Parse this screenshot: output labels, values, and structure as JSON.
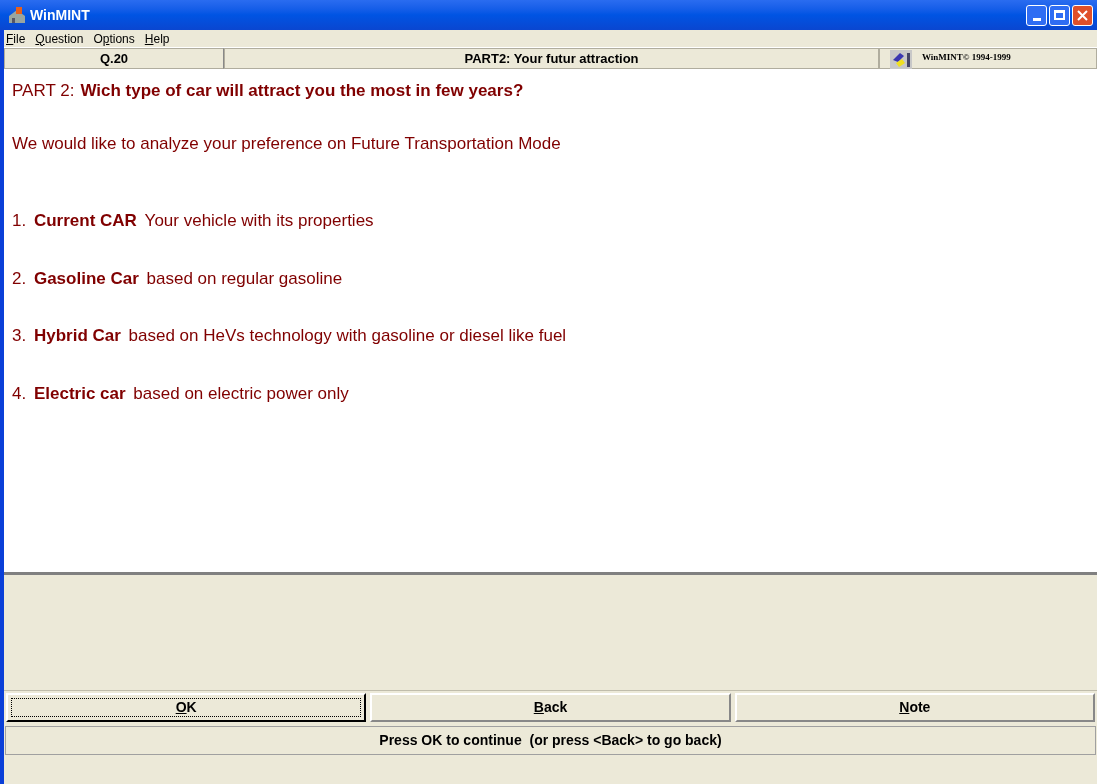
{
  "window": {
    "title": "WinMINT"
  },
  "menu": [
    {
      "key": "F",
      "post": "ile"
    },
    {
      "key": "Q",
      "post": "uestion"
    },
    {
      "pre": "O",
      "key": "p",
      "post": "tions"
    },
    {
      "key": "H",
      "post": "elp"
    }
  ],
  "header": {
    "question_number": "Q.20",
    "part_title": "PART2: Your futur attraction",
    "copyright": "WinMINT© 1994-1999"
  },
  "question": {
    "prefix": "PART 2:",
    "text": "Wich type of car will attract you the most in few years?"
  },
  "intro": "We would like to analyze your preference on Future Transportation Mode",
  "options": [
    {
      "number": "1.",
      "name": "Current CAR",
      "description": "Your vehicle with its properties"
    },
    {
      "number": "2.",
      "name": "Gasoline Car",
      "description": "based on regular gasoline"
    },
    {
      "number": "3.",
      "name": "Hybrid Car",
      "description": "based on HeVs technology with gasoline or diesel like fuel"
    },
    {
      "number": "4.",
      "name": "Electric car",
      "description": "based on electric power only"
    }
  ],
  "buttons": [
    {
      "key": "O",
      "post": "K",
      "selected": true
    },
    {
      "key": "B",
      "post": "ack",
      "selected": false
    },
    {
      "key": "N",
      "post": "ote",
      "selected": false
    }
  ],
  "status_bar": "Press OK to continue  (or press <Back> to go back)"
}
